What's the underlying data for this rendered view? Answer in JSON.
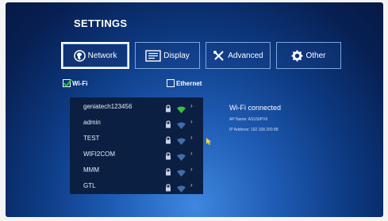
{
  "settings": {
    "title": "SETTINGS",
    "tabs": [
      {
        "label": "Network",
        "icon": "globe-icon",
        "active": true
      },
      {
        "label": "Display",
        "icon": "display-icon",
        "active": false
      },
      {
        "label": "Advanced",
        "icon": "tools-icon",
        "active": false
      },
      {
        "label": "Other",
        "icon": "gear-icon",
        "active": false
      }
    ],
    "wifi": {
      "label": "Wi-Fi",
      "checked": true
    },
    "ethernet": {
      "label": "Ethernet",
      "checked": false
    },
    "networks": [
      {
        "name": "geniatech123456",
        "signal_active": true
      },
      {
        "name": "admin",
        "signal_active": false
      },
      {
        "name": "TEST",
        "signal_active": false
      },
      {
        "name": "WIFI2COM",
        "signal_active": false
      },
      {
        "name": "MMM",
        "signal_active": false
      },
      {
        "name": "GTL",
        "signal_active": false
      }
    ],
    "status": {
      "title": "Wi-Fi connected",
      "ap_name": "AP Name:  ASUSIPV6",
      "ip_address": "IP Address:  192.168.200.88"
    },
    "colors": {
      "signal_active": "#36c23c",
      "signal_inactive": "#3f6ea8",
      "checkbox_checked": "#2fc43b"
    }
  }
}
